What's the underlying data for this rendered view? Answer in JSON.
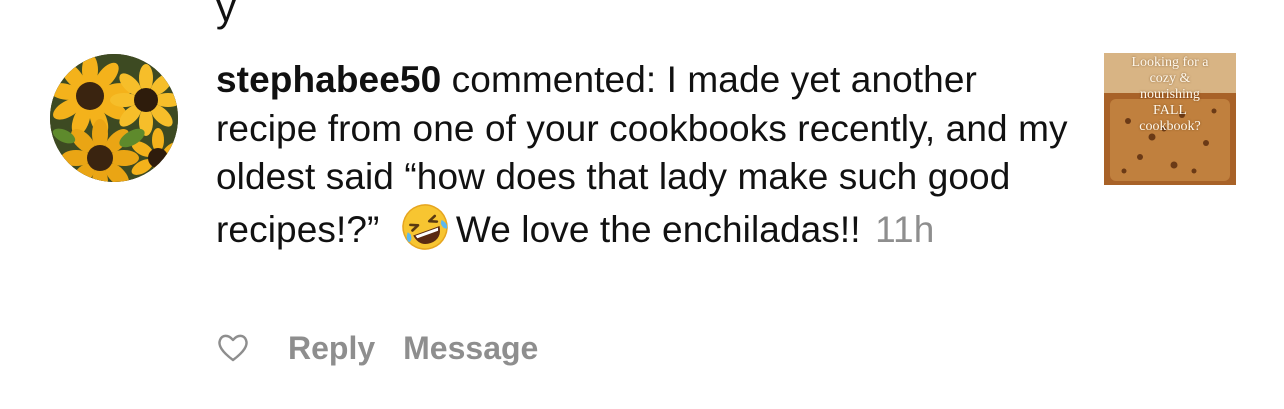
{
  "comment": {
    "username": "stephabee50",
    "action_text": " commented: I made yet another recipe from one of your cookbooks recently, and my oldest said “how does that lady make such good recipes!?”",
    "emoji": "rolling-on-floor-laughing",
    "text_after_emoji": "We love the enchiladas!!",
    "time_ago": "11h"
  },
  "thumbnail": {
    "lines": [
      "Looking for a",
      "cozy &",
      "nourishing",
      "FALL",
      "cookbook?"
    ]
  },
  "actions": {
    "like_icon": "heart-outline-icon",
    "reply_label": "Reply",
    "message_label": "Message"
  },
  "colors": {
    "text": "#111111",
    "secondary": "#8e8e8e",
    "emoji_face": "#f7c531"
  }
}
